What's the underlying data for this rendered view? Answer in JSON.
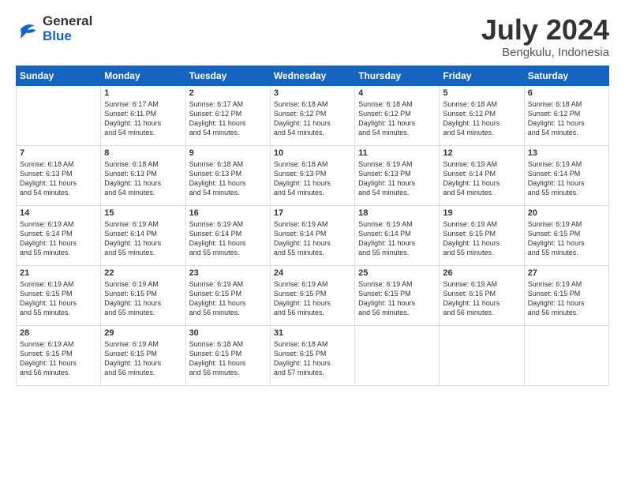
{
  "logo": {
    "general": "General",
    "blue": "Blue"
  },
  "title": "July 2024",
  "subtitle": "Bengkulu, Indonesia",
  "days": [
    "Sunday",
    "Monday",
    "Tuesday",
    "Wednesday",
    "Thursday",
    "Friday",
    "Saturday"
  ],
  "weeks": [
    [
      {
        "day": "",
        "info": ""
      },
      {
        "day": "1",
        "info": "Sunrise: 6:17 AM\nSunset: 6:11 PM\nDaylight: 11 hours\nand 54 minutes."
      },
      {
        "day": "2",
        "info": "Sunrise: 6:17 AM\nSunset: 6:12 PM\nDaylight: 11 hours\nand 54 minutes."
      },
      {
        "day": "3",
        "info": "Sunrise: 6:18 AM\nSunset: 6:12 PM\nDaylight: 11 hours\nand 54 minutes."
      },
      {
        "day": "4",
        "info": "Sunrise: 6:18 AM\nSunset: 6:12 PM\nDaylight: 11 hours\nand 54 minutes."
      },
      {
        "day": "5",
        "info": "Sunrise: 6:18 AM\nSunset: 6:12 PM\nDaylight: 11 hours\nand 54 minutes."
      },
      {
        "day": "6",
        "info": "Sunrise: 6:18 AM\nSunset: 6:12 PM\nDaylight: 11 hours\nand 54 minutes."
      }
    ],
    [
      {
        "day": "7",
        "info": "Sunrise: 6:18 AM\nSunset: 6:13 PM\nDaylight: 11 hours\nand 54 minutes."
      },
      {
        "day": "8",
        "info": "Sunrise: 6:18 AM\nSunset: 6:13 PM\nDaylight: 11 hours\nand 54 minutes."
      },
      {
        "day": "9",
        "info": "Sunrise: 6:18 AM\nSunset: 6:13 PM\nDaylight: 11 hours\nand 54 minutes."
      },
      {
        "day": "10",
        "info": "Sunrise: 6:18 AM\nSunset: 6:13 PM\nDaylight: 11 hours\nand 54 minutes."
      },
      {
        "day": "11",
        "info": "Sunrise: 6:19 AM\nSunset: 6:13 PM\nDaylight: 11 hours\nand 54 minutes."
      },
      {
        "day": "12",
        "info": "Sunrise: 6:19 AM\nSunset: 6:14 PM\nDaylight: 11 hours\nand 54 minutes."
      },
      {
        "day": "13",
        "info": "Sunrise: 6:19 AM\nSunset: 6:14 PM\nDaylight: 11 hours\nand 55 minutes."
      }
    ],
    [
      {
        "day": "14",
        "info": "Sunrise: 6:19 AM\nSunset: 6:14 PM\nDaylight: 11 hours\nand 55 minutes."
      },
      {
        "day": "15",
        "info": "Sunrise: 6:19 AM\nSunset: 6:14 PM\nDaylight: 11 hours\nand 55 minutes."
      },
      {
        "day": "16",
        "info": "Sunrise: 6:19 AM\nSunset: 6:14 PM\nDaylight: 11 hours\nand 55 minutes."
      },
      {
        "day": "17",
        "info": "Sunrise: 6:19 AM\nSunset: 6:14 PM\nDaylight: 11 hours\nand 55 minutes."
      },
      {
        "day": "18",
        "info": "Sunrise: 6:19 AM\nSunset: 6:14 PM\nDaylight: 11 hours\nand 55 minutes."
      },
      {
        "day": "19",
        "info": "Sunrise: 6:19 AM\nSunset: 6:15 PM\nDaylight: 11 hours\nand 55 minutes."
      },
      {
        "day": "20",
        "info": "Sunrise: 6:19 AM\nSunset: 6:15 PM\nDaylight: 11 hours\nand 55 minutes."
      }
    ],
    [
      {
        "day": "21",
        "info": "Sunrise: 6:19 AM\nSunset: 6:15 PM\nDaylight: 11 hours\nand 55 minutes."
      },
      {
        "day": "22",
        "info": "Sunrise: 6:19 AM\nSunset: 6:15 PM\nDaylight: 11 hours\nand 55 minutes."
      },
      {
        "day": "23",
        "info": "Sunrise: 6:19 AM\nSunset: 6:15 PM\nDaylight: 11 hours\nand 56 minutes."
      },
      {
        "day": "24",
        "info": "Sunrise: 6:19 AM\nSunset: 6:15 PM\nDaylight: 11 hours\nand 56 minutes."
      },
      {
        "day": "25",
        "info": "Sunrise: 6:19 AM\nSunset: 6:15 PM\nDaylight: 11 hours\nand 56 minutes."
      },
      {
        "day": "26",
        "info": "Sunrise: 6:19 AM\nSunset: 6:15 PM\nDaylight: 11 hours\nand 56 minutes."
      },
      {
        "day": "27",
        "info": "Sunrise: 6:19 AM\nSunset: 6:15 PM\nDaylight: 11 hours\nand 56 minutes."
      }
    ],
    [
      {
        "day": "28",
        "info": "Sunrise: 6:19 AM\nSunset: 6:15 PM\nDaylight: 11 hours\nand 56 minutes."
      },
      {
        "day": "29",
        "info": "Sunrise: 6:19 AM\nSunset: 6:15 PM\nDaylight: 11 hours\nand 56 minutes."
      },
      {
        "day": "30",
        "info": "Sunrise: 6:18 AM\nSunset: 6:15 PM\nDaylight: 11 hours\nand 56 minutes."
      },
      {
        "day": "31",
        "info": "Sunrise: 6:18 AM\nSunset: 6:15 PM\nDaylight: 11 hours\nand 57 minutes."
      },
      {
        "day": "",
        "info": ""
      },
      {
        "day": "",
        "info": ""
      },
      {
        "day": "",
        "info": ""
      }
    ]
  ]
}
